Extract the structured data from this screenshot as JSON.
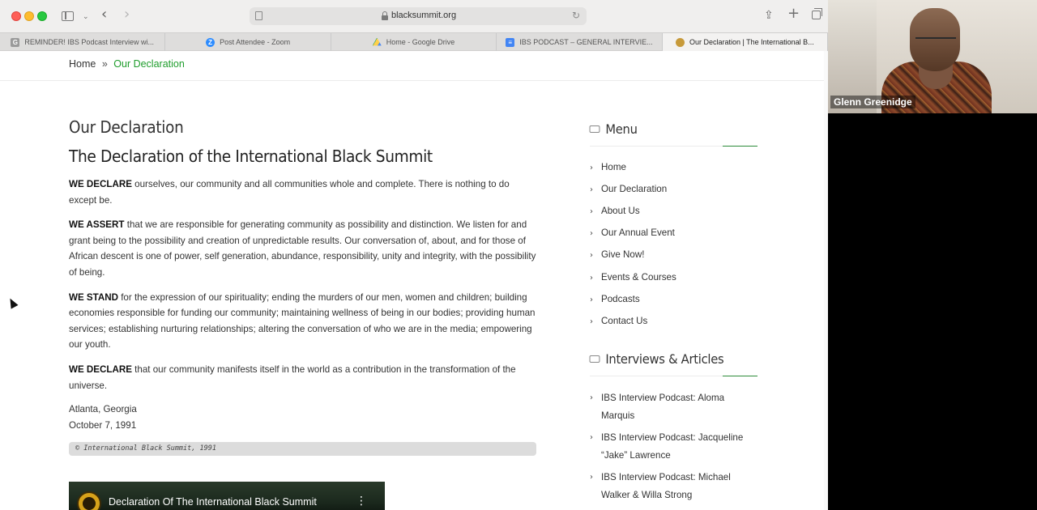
{
  "browser": {
    "url": "blacksummit.org",
    "tabs": [
      {
        "title": "REMINDER! IBS Podcast Interview wi...",
        "favicon": "gmail-icon",
        "active": false
      },
      {
        "title": "Post Attendee - Zoom",
        "favicon": "zoom-icon",
        "active": false
      },
      {
        "title": "Home - Google Drive",
        "favicon": "drive-icon",
        "active": false
      },
      {
        "title": "IBS PODCAST – GENERAL INTERVIE...",
        "favicon": "docs-icon",
        "active": false
      },
      {
        "title": "Our Declaration | The International B...",
        "favicon": "site-icon",
        "active": true
      }
    ]
  },
  "breadcrumb": {
    "home": "Home",
    "separator": "»",
    "current": "Our Declaration"
  },
  "main": {
    "page_title": "Our Declaration",
    "heading": "The Declaration of the International Black Summit",
    "paragraphs": [
      {
        "lead": "WE DECLARE",
        "text": " ourselves, our community and all communities whole and complete. There is nothing to do except be."
      },
      {
        "lead": "WE ASSERT",
        "text": " that we are responsible for generating community as possibility and distinction. We listen for and grant being to the possibility and creation of unpredictable results. Our conversation of, about, and for those of African descent is one of power, self generation, abundance, responsibility, unity and integrity, with the possibility of being."
      },
      {
        "lead": "WE STAND",
        "text": " for the expression of our spirituality; ending the murders of our men, women and children; building economies responsible for funding our community; maintaining wellness of being in our bodies; providing human services; establishing nurturing relationships; altering the conversation of who we are in the media; empowering our youth."
      },
      {
        "lead": "WE DECLARE",
        "text": " that our community manifests itself in the world as a contribution in the transformation of the universe."
      }
    ],
    "place": "Atlanta, Georgia",
    "date": "October 7, 1991",
    "copyright": "© International Black Summit, 1991",
    "video_title": "Declaration Of The International Black Summit"
  },
  "sidebar": {
    "menu_title": "Menu",
    "menu_items": [
      "Home",
      "Our Declaration",
      "About Us",
      "Our Annual Event",
      "Give Now!",
      "Events & Courses",
      "Podcasts",
      "Contact Us"
    ],
    "articles_title": "Interviews & Articles",
    "articles": [
      "IBS Interview Podcast: Aloma Marquis",
      "IBS Interview Podcast: Jacqueline “Jake” Lawrence",
      "IBS Interview Podcast: Michael Walker & Willa Strong"
    ]
  },
  "zoom": {
    "participant_name": "Glenn Greenidge"
  },
  "colors": {
    "accent_green": "#1f9d2c",
    "rule_green": "#2e8b3a"
  }
}
